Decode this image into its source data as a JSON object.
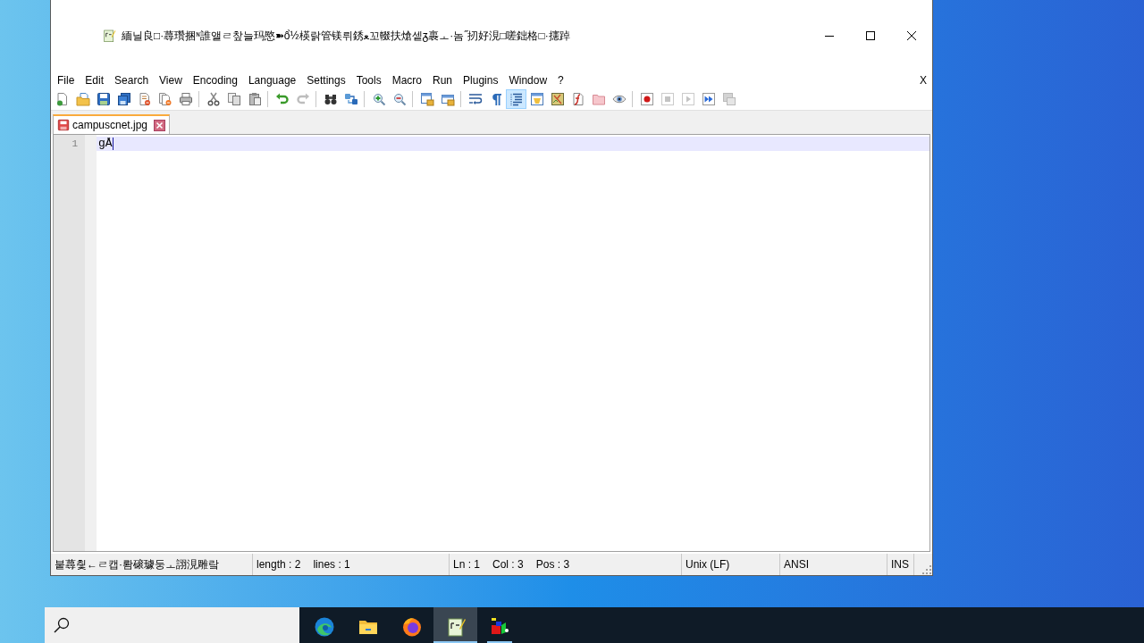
{
  "window": {
    "title": "緬닐良□·蕁瓚捆ᶰ誰앨ㄹ챂늘玛愍➽ổ½楧랅管镁뤼銹ﻌ꼬輟扶熗셑ᵹ裹ㅗ·놈˝扨好涀□嗟鈯格□·攇踔"
  },
  "menu": {
    "items": [
      "File",
      "Edit",
      "Search",
      "View",
      "Encoding",
      "Language",
      "Settings",
      "Tools",
      "Macro",
      "Run",
      "Plugins",
      "Window",
      "?"
    ],
    "close": "X"
  },
  "toolbar": [
    [
      {
        "pressed": false,
        "disabled": false
      },
      {
        "pressed": false,
        "disabled": false
      },
      {
        "pressed": false,
        "disabled": false
      },
      {
        "pressed": false,
        "disabled": false
      },
      {
        "pressed": false,
        "disabled": false
      },
      {
        "pressed": false,
        "disabled": false
      },
      {
        "pressed": false,
        "disabled": false
      }
    ],
    [
      {
        "pressed": false,
        "disabled": false
      },
      {
        "pressed": false,
        "disabled": false
      },
      {
        "pressed": false,
        "disabled": false
      }
    ],
    [
      {
        "pressed": false,
        "disabled": false
      },
      {
        "pressed": false,
        "disabled": true
      }
    ],
    [
      {
        "pressed": false,
        "disabled": false
      },
      {
        "pressed": false,
        "disabled": false
      }
    ],
    [
      {
        "pressed": false,
        "disabled": false
      },
      {
        "pressed": false,
        "disabled": false
      }
    ],
    [
      {
        "pressed": false,
        "disabled": false
      },
      {
        "pressed": false,
        "disabled": false
      }
    ],
    [
      {
        "pressed": false,
        "disabled": false
      },
      {
        "pressed": false,
        "disabled": false
      },
      {
        "pressed": true,
        "disabled": false
      },
      {
        "pressed": false,
        "disabled": false
      },
      {
        "pressed": false,
        "disabled": false
      },
      {
        "pressed": false,
        "disabled": false
      },
      {
        "pressed": false,
        "disabled": false
      },
      {
        "pressed": false,
        "disabled": false
      }
    ],
    [
      {
        "pressed": false,
        "disabled": false
      },
      {
        "pressed": false,
        "disabled": true
      },
      {
        "pressed": false,
        "disabled": true
      },
      {
        "pressed": false,
        "disabled": false
      },
      {
        "pressed": false,
        "disabled": true
      }
    ]
  ],
  "tabs": [
    {
      "label": "campuscnet.jpg",
      "selected": true,
      "modified": true
    }
  ],
  "editor": {
    "lines": [
      {
        "number": "1",
        "text": "gÅ",
        "current": true
      }
    ]
  },
  "status_bar": {
    "message": "붙蕁칓←ㄹ캡·뢈磙璩둥ㅗ詡涀雕랔",
    "length": "length : 2",
    "lines": "lines : 1",
    "ln": "Ln : 1",
    "col": "Col : 3",
    "pos": "Pos : 3",
    "eol": "Unix (LF)",
    "encoding": "ANSI",
    "mode": "INS"
  },
  "taskbar": {
    "apps": [
      {
        "selected": false,
        "running": false
      },
      {
        "selected": false,
        "running": false
      },
      {
        "selected": false,
        "running": false
      },
      {
        "selected": true,
        "running": true
      },
      {
        "selected": false,
        "running": true
      }
    ]
  }
}
